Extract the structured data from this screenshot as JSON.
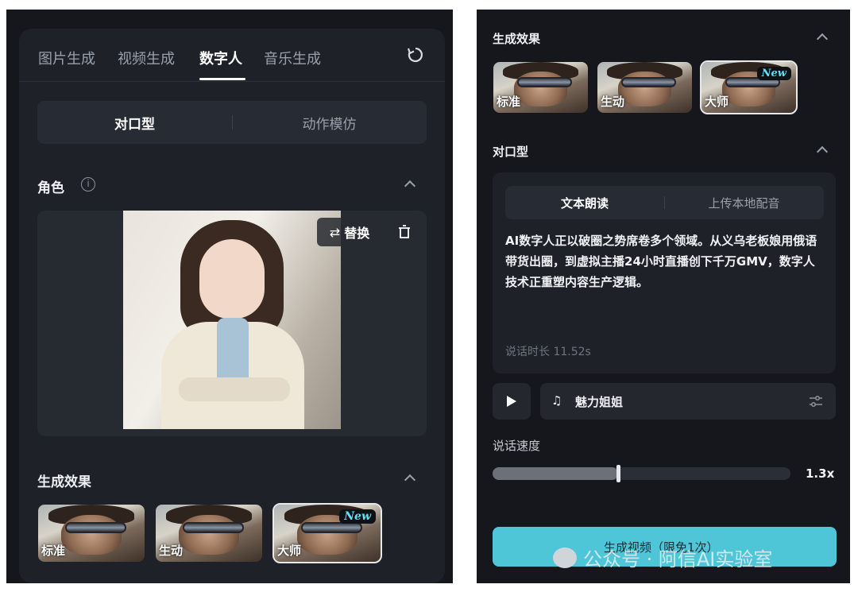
{
  "left": {
    "tabs": [
      "图片生成",
      "视频生成",
      "数字人",
      "音乐生成"
    ],
    "active_tab": "数字人",
    "mode": {
      "options": [
        "对口型",
        "动作模仿"
      ],
      "selected": "对口型"
    },
    "role": {
      "title": "角色",
      "info_icon": "info-icon",
      "replace_label": "替换"
    },
    "effects": {
      "title": "生成效果",
      "items": [
        "标准",
        "生动",
        "大师"
      ],
      "new_badge": "New",
      "selected": "大师"
    }
  },
  "right": {
    "effects": {
      "title": "生成效果",
      "items": [
        "标准",
        "生动",
        "大师"
      ],
      "new_badge": "New",
      "selected": "大师"
    },
    "lipsync": {
      "title": "对口型",
      "modes": [
        "文本朗读",
        "上传本地配音"
      ],
      "selected_mode": "文本朗读",
      "text": "AI数字人正以破圈之势席卷多个领域。从义乌老板娘用俄语带货出圈，到虚拟主播24小时直播创下千万GMV，数字人技术正重塑内容生产逻辑。",
      "duration": "说话时长 11.52s"
    },
    "voice": {
      "name": "魅力姐姐"
    },
    "speed": {
      "label": "说话速度",
      "value_label": "1.3x",
      "fraction": 0.42
    },
    "generate_button": "生成视频（限免1次）",
    "watermark": "公众号 · 阿信AI实验室"
  }
}
